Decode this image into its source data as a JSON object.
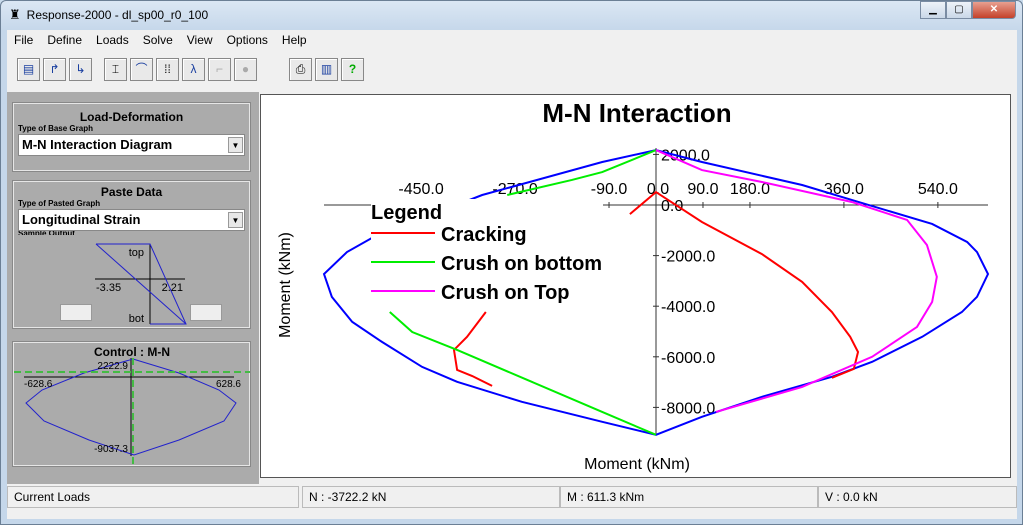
{
  "window": {
    "title": "Response-2000  -  dl_sp00_r0_100",
    "app_icon": "response-2000-icon"
  },
  "menu": [
    "File",
    "Define",
    "Loads",
    "Solve",
    "View",
    "Options",
    "Help"
  ],
  "toolbar": [
    "new-icon",
    "open-icon",
    "save-icon",
    "section-icon",
    "load-deformation-icon",
    "grid-icon",
    "interaction-icon",
    "member-icon",
    "stop-icon",
    "print-icon",
    "book-icon",
    "help-icon"
  ],
  "left": {
    "load_deformation": {
      "title": "Load-Deformation",
      "label": "Type of Base Graph",
      "value": "M-N Interaction Diagram"
    },
    "paste_data": {
      "title": "Paste Data",
      "label": "Type of Pasted Graph",
      "value": "Longitudinal Strain",
      "sample_label": "Sample Output",
      "top": "top",
      "bot": "bot",
      "left_value": "-3.35",
      "right_value": "2.21"
    },
    "control": {
      "title": "Control : M-N",
      "top": "2222.9",
      "left": "-628.6",
      "right": "628.6",
      "bottom": "-9037.3"
    }
  },
  "status": {
    "label": "Current Loads",
    "n": "N : -3722.2 kN",
    "m": "M : 611.3 kNm",
    "v": "V :  0.0 kN"
  },
  "chart_data": {
    "type": "line",
    "title": "M-N Interaction",
    "xlabel": "Moment (kNm)",
    "ylabel": "Moment (kNm)",
    "xticks": [
      -450,
      -270,
      -90,
      0,
      90,
      180,
      360,
      540
    ],
    "xtick_labels": [
      "-450.0",
      "-270.0",
      "-90.0",
      "0.0",
      "90.0",
      "180.0",
      "360.0",
      "540.0"
    ],
    "yticks": [
      2000,
      0,
      -2000,
      -4000,
      -6000,
      -8000
    ],
    "ytick_labels": [
      "2000.0",
      "0.0",
      "-2000.0",
      "-4000.0",
      "-6000.0",
      "-8000.0"
    ],
    "legend": {
      "title": "Legend",
      "placement": "left"
    },
    "series": [
      {
        "name": "",
        "color": "#0000ff",
        "points": [
          [
            0,
            2170
          ],
          [
            -103,
            1700
          ],
          [
            -333,
            395
          ],
          [
            -544,
            -1300
          ],
          [
            -592,
            -1860
          ],
          [
            -636,
            -2730
          ],
          [
            -621,
            -3630
          ],
          [
            -582,
            -4620
          ],
          [
            -525,
            -5410
          ],
          [
            -448,
            -6400
          ],
          [
            -381,
            -6990
          ],
          [
            -257,
            -7780
          ],
          [
            -103,
            -8570
          ],
          [
            0,
            -9085
          ],
          [
            88,
            -8370
          ],
          [
            203,
            -7580
          ],
          [
            337,
            -6790
          ],
          [
            414,
            -6200
          ],
          [
            510,
            -5210
          ],
          [
            586,
            -4230
          ],
          [
            615,
            -3630
          ],
          [
            636,
            -2730
          ],
          [
            615,
            -1860
          ],
          [
            596,
            -1460
          ],
          [
            529,
            -750
          ],
          [
            375,
            200
          ],
          [
            280,
            790
          ],
          [
            88,
            1700
          ],
          [
            0,
            2170
          ]
        ]
      },
      {
        "name": "Cracking",
        "color": "#ff0000",
        "segments": [
          [
            [
              -50,
              -360
            ],
            [
              0,
              510
            ],
            [
              88,
              -670
            ],
            [
              203,
              -1940
            ],
            [
              280,
              -3040
            ],
            [
              337,
              -4230
            ],
            [
              372,
              -5210
            ],
            [
              387,
              -5810
            ],
            [
              379,
              -6480
            ],
            [
              337,
              -6830
            ]
          ],
          [
            [
              -326,
              -4230
            ],
            [
              -362,
              -5210
            ],
            [
              -387,
              -5730
            ],
            [
              -381,
              -6520
            ],
            [
              -352,
              -6760
            ],
            [
              -314,
              -7150
            ]
          ]
        ]
      },
      {
        "name": "Crush on bottom",
        "color": "#00ee00",
        "segments": [
          [
            [
              0,
              2170
            ],
            [
              -103,
              1300
            ],
            [
              -161,
              990
            ],
            [
              -285,
              395
            ]
          ],
          [
            [
              -510,
              -4230
            ],
            [
              -467,
              -5020
            ],
            [
              -381,
              -5730
            ],
            [
              -238,
              -6990
            ],
            [
              -103,
              -8180
            ],
            [
              0,
              -9085
            ]
          ]
        ]
      },
      {
        "name": "Crush on Top",
        "color": "#ff00ff",
        "segments": [
          [
            [
              0,
              2170
            ],
            [
              88,
              1380
            ],
            [
              203,
              910
            ],
            [
              375,
              120
            ],
            [
              481,
              -590
            ],
            [
              519,
              -1580
            ],
            [
              538,
              -2840
            ],
            [
              529,
              -3830
            ],
            [
              500,
              -4820
            ],
            [
              414,
              -6000
            ],
            [
              280,
              -7190
            ],
            [
              115,
              -8180
            ]
          ]
        ]
      }
    ]
  }
}
